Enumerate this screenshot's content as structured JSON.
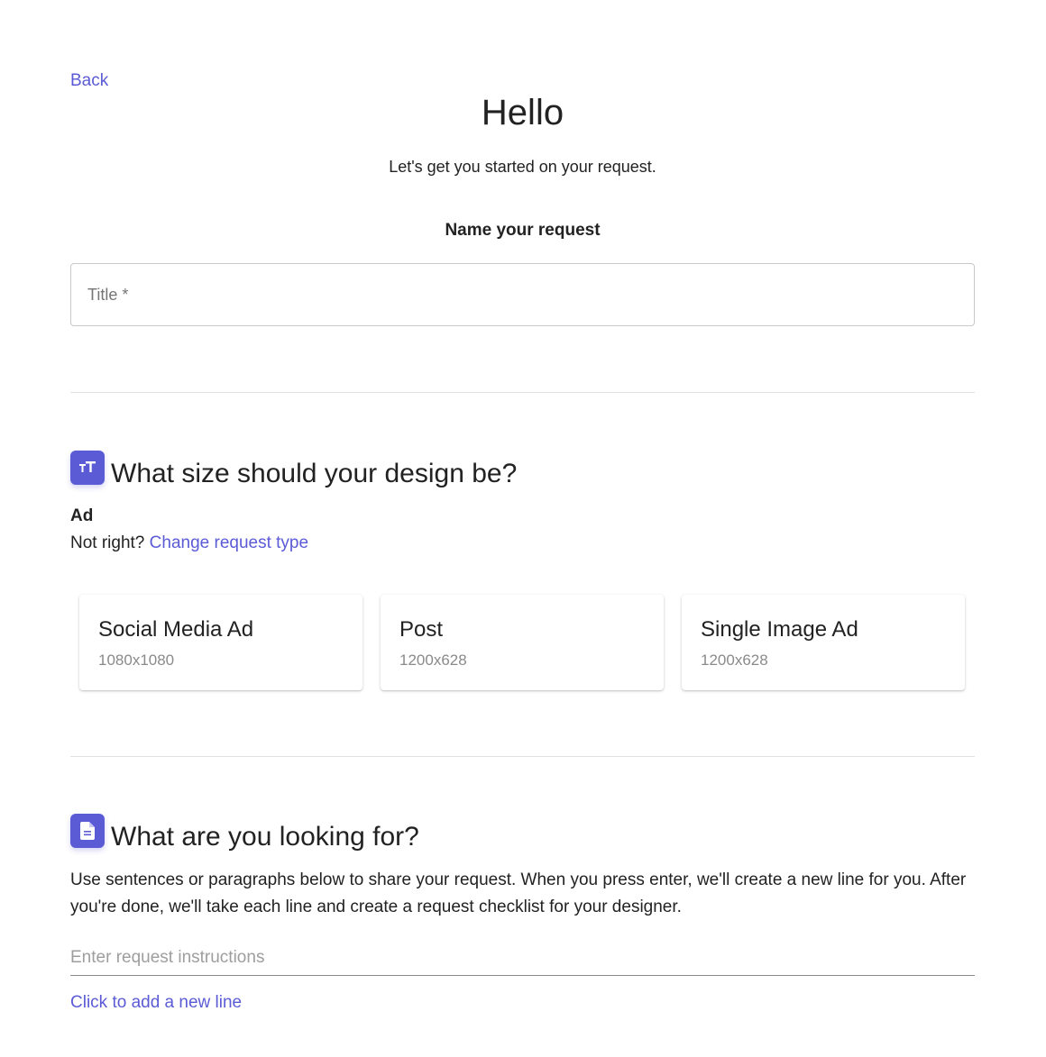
{
  "nav": {
    "back_label": "Back"
  },
  "header": {
    "title": "Hello",
    "subtitle": "Let's get you started on your request."
  },
  "name_section": {
    "heading": "Name your request",
    "title_placeholder": "Title *",
    "title_value": ""
  },
  "size_section": {
    "icon": "text-size-icon",
    "heading": "What size should your design be?",
    "type_label": "Ad",
    "not_right_text": "Not right?",
    "change_link": "Change request type",
    "options": [
      {
        "name": "Social Media Ad",
        "size": "1080x1080"
      },
      {
        "name": "Post",
        "size": "1200x628"
      },
      {
        "name": "Single Image Ad",
        "size": "1200x628"
      }
    ]
  },
  "instructions_section": {
    "icon": "document-icon",
    "heading": "What are you looking for?",
    "description": "Use sentences or paragraphs below to share your request. When you press enter, we'll create a new line for you. After you're done, we'll take each line and create a request checklist for your designer.",
    "input_placeholder": "Enter request instructions",
    "input_value": "",
    "add_line_label": "Click to add a new line"
  },
  "colors": {
    "accent": "#5b5bd6",
    "text": "#222222",
    "muted": "#8a8a8a",
    "divider": "#e2e2e2"
  }
}
